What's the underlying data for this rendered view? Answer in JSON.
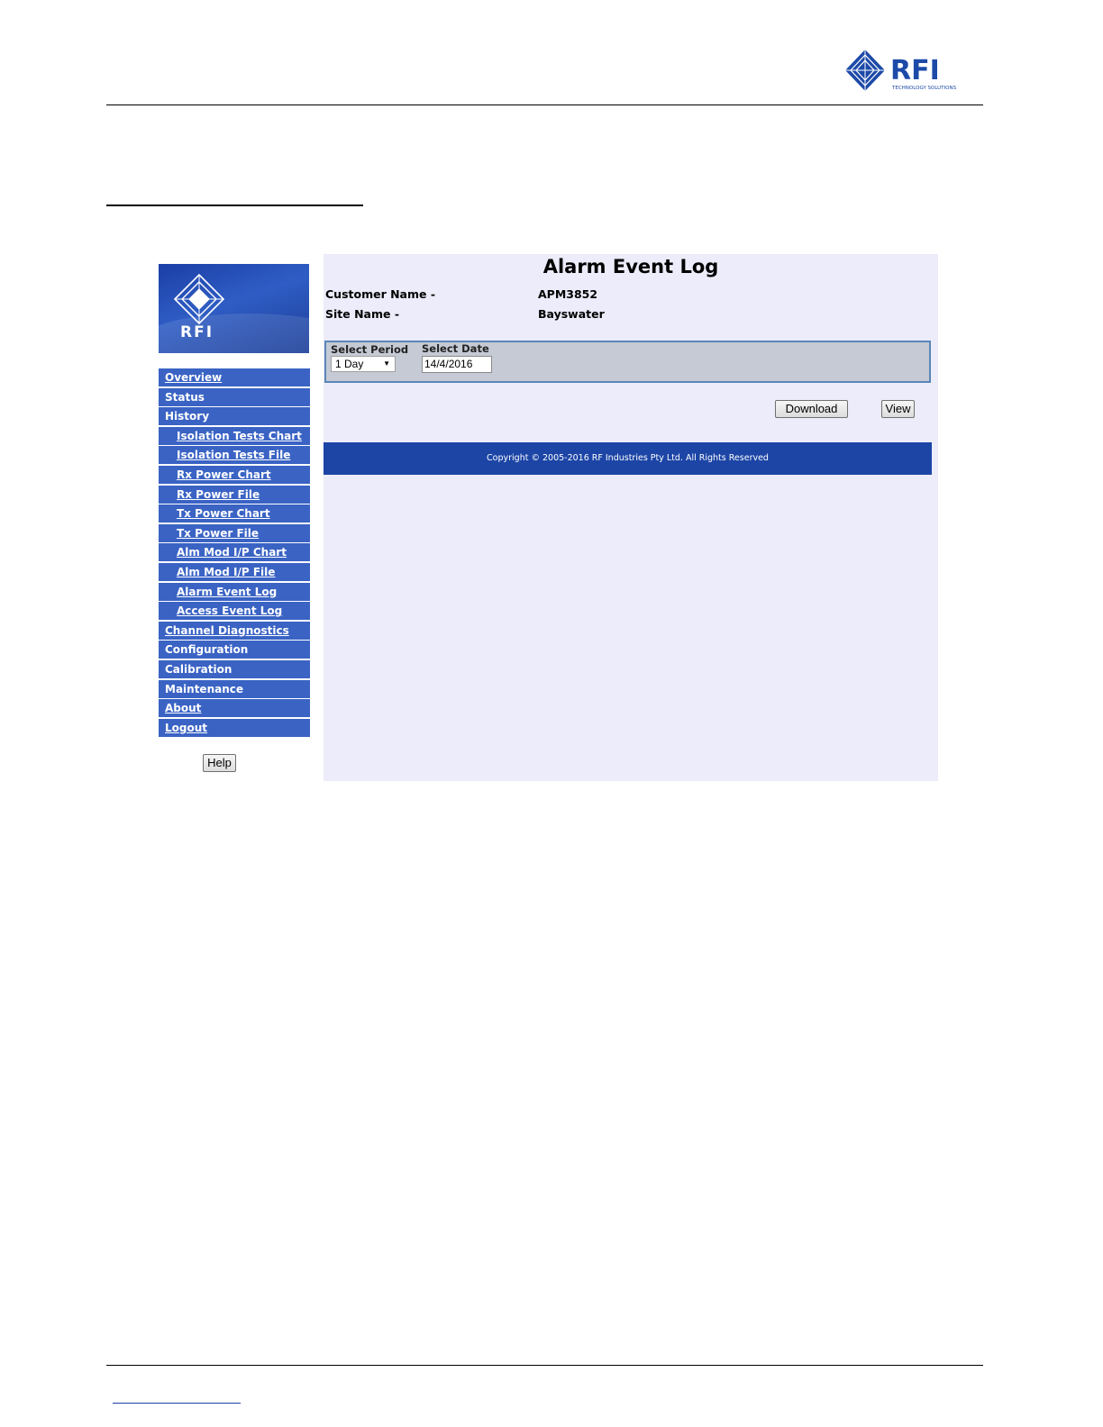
{
  "document": {
    "brand_name": "RFI",
    "brand_tagline": "TECHNOLOGY SOLUTIONS"
  },
  "sidebar": {
    "logo_text": "RFI",
    "items": [
      {
        "label": "Overview",
        "link": true,
        "sub": false
      },
      {
        "label": "Status",
        "link": false,
        "sub": false
      },
      {
        "label": "History",
        "link": false,
        "sub": false
      },
      {
        "label": "Isolation Tests Chart",
        "link": true,
        "sub": true
      },
      {
        "label": "Isolation Tests File",
        "link": true,
        "sub": true
      },
      {
        "label": "Rx Power Chart",
        "link": true,
        "sub": true
      },
      {
        "label": "Rx Power File",
        "link": true,
        "sub": true
      },
      {
        "label": "Tx Power Chart",
        "link": true,
        "sub": true
      },
      {
        "label": "Tx Power File",
        "link": true,
        "sub": true
      },
      {
        "label": "Alm Mod I/P Chart",
        "link": true,
        "sub": true
      },
      {
        "label": "Alm Mod I/P File",
        "link": true,
        "sub": true
      },
      {
        "label": "Alarm Event Log",
        "link": true,
        "sub": true
      },
      {
        "label": "Access Event Log",
        "link": true,
        "sub": true
      },
      {
        "label": "Channel Diagnostics",
        "link": true,
        "sub": false
      },
      {
        "label": "Configuration",
        "link": false,
        "sub": false
      },
      {
        "label": "Calibration",
        "link": false,
        "sub": false
      },
      {
        "label": "Maintenance",
        "link": false,
        "sub": false
      },
      {
        "label": "About",
        "link": true,
        "sub": false
      },
      {
        "label": "Logout",
        "link": true,
        "sub": false
      }
    ],
    "help_label": "Help"
  },
  "main": {
    "title": "Alarm Event Log",
    "customer_label": "Customer Name -",
    "customer_value": "APM3852",
    "site_label": "Site Name -",
    "site_value": "Bayswater",
    "period_label": "Select Period",
    "period_value": "1 Day",
    "date_label": "Select Date",
    "date_value": "14/4/2016",
    "download_label": "Download",
    "view_label": "View",
    "copyright": "Copyright © 2005-2016 RF Industries Pty Ltd. All Rights Reserved"
  },
  "colors": {
    "nav_item": "#3a63c4",
    "copyright_bar": "#1c45a6",
    "main_background": "#ececfa"
  }
}
